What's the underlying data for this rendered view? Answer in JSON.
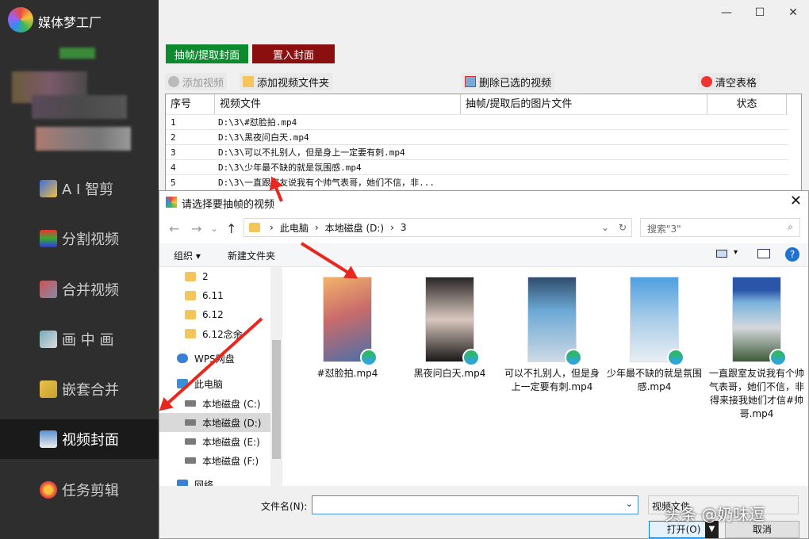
{
  "app": {
    "title": "媒体梦工厂"
  },
  "sidebar": {
    "items": [
      {
        "label": "A I 智剪",
        "icon": "ai-cut-icon"
      },
      {
        "label": "分割视频",
        "icon": "split-icon"
      },
      {
        "label": "合并视频",
        "icon": "merge-icon"
      },
      {
        "label": "画 中 画",
        "icon": "pip-icon"
      },
      {
        "label": "嵌套合并",
        "icon": "nest-icon"
      },
      {
        "label": "视频封面",
        "icon": "cover-icon",
        "active": true
      },
      {
        "label": "任务剪辑",
        "icon": "task-icon"
      }
    ]
  },
  "toolbar": {
    "tab_extract": "抽帧/提取封面",
    "tab_insert": "置入封面",
    "add_video": "添加视频",
    "add_folder": "添加视频文件夹",
    "delete_selected": "删除已选的视频",
    "clear_table": "清空表格"
  },
  "table": {
    "headers": [
      "序号",
      "视频文件",
      "抽帧/提取后的图片文件",
      "状态"
    ],
    "rows": [
      {
        "no": "1",
        "file": "D:\\3\\#怼脸拍.mp4"
      },
      {
        "no": "2",
        "file": "D:\\3\\黑夜问白天.mp4"
      },
      {
        "no": "3",
        "file": "D:\\3\\可以不扎别人，但是身上一定要有刺.mp4"
      },
      {
        "no": "4",
        "file": "D:\\3\\少年最不缺的就是氛围感.mp4"
      },
      {
        "no": "5",
        "file": "D:\\3\\一直跟室友说我有个帅气表哥，她们不信，非..."
      }
    ]
  },
  "dialog": {
    "title": "请选择要抽帧的视频",
    "path": [
      "此电脑",
      "本地磁盘 (D:)",
      "3"
    ],
    "search_placeholder": "搜索\"3\"",
    "organize": "组织",
    "new_folder": "新建文件夹",
    "tree": [
      {
        "label": "2",
        "type": "folder"
      },
      {
        "label": "6.11",
        "type": "folder"
      },
      {
        "label": "6.12",
        "type": "folder"
      },
      {
        "label": "6.12念余",
        "type": "folder"
      },
      {
        "label": "WPS网盘",
        "type": "cloud"
      },
      {
        "label": "此电脑",
        "type": "pc"
      },
      {
        "label": "本地磁盘 (C:)",
        "type": "drive"
      },
      {
        "label": "本地磁盘 (D:)",
        "type": "drive",
        "selected": true
      },
      {
        "label": "本地磁盘 (E:)",
        "type": "drive"
      },
      {
        "label": "本地磁盘 (F:)",
        "type": "drive"
      },
      {
        "label": "网络",
        "type": "network"
      }
    ],
    "files": [
      {
        "name": "#怼脸拍.mp4",
        "colors": [
          "#f2b36a",
          "#4a6fa8"
        ]
      },
      {
        "name": "黑夜问白天.mp4",
        "colors": [
          "#2a2626",
          "#d9c8bf"
        ]
      },
      {
        "name": "可以不扎别人，但是身上一定要有刺.mp4",
        "colors": [
          "#6da9d6",
          "#cdd9e5"
        ]
      },
      {
        "name": "少年最不缺的就是氛围感.mp4",
        "colors": [
          "#4f9fe0",
          "#e9eef3"
        ]
      },
      {
        "name": "一直跟室友说我有个帅气表哥，她们不信，非得来接我她们才信#帅哥.mp4",
        "colors": [
          "#7bb3dd",
          "#3d5a3a"
        ]
      }
    ],
    "filename_label": "文件名(N):",
    "filetype": "视频文件",
    "open": "打开(O)",
    "cancel": "取消"
  },
  "watermark": "头条 @奶味逗"
}
